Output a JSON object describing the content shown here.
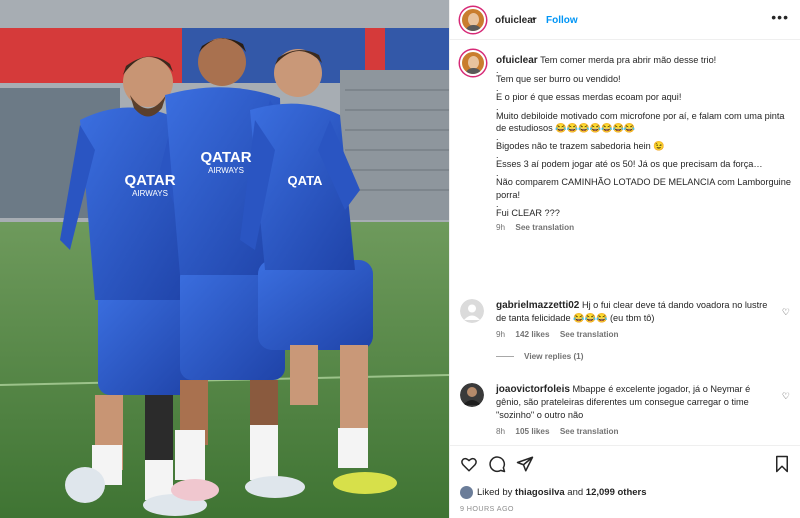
{
  "post": {
    "username": "ofuiclear",
    "follow_label": "Follow",
    "more_label": "•••"
  },
  "photo": {
    "shirt_text": "QATAR AIRWAYS",
    "jersey_lines": [
      "QATAR",
      "AIRWAYS"
    ]
  },
  "caption": {
    "username": "ofuiclear",
    "lines": [
      "Tem comer merda pra abrir mão desse trio!",
      "Tem que ser burro ou vendido!",
      "E o pior é que essas merdas ecoam por aqui!",
      "Muito debiloide motivado com microfone por aí, e falam com uma pinta de estudiosos 😂😂😂😂😂😂😂",
      "Bigodes não te trazem sabedoria hein 😉",
      "Esses 3 aí podem jogar até os 50! Já os que precisam da força…",
      "Não comparem CAMINHÃO LOTADO DE MELANCIA com Lamborguine porra!",
      "Fui CLEAR ???"
    ],
    "time": "9h",
    "see_translation": "See translation"
  },
  "comments": [
    {
      "username": "gabrielmazzetti02",
      "text": "Hj o fui clear deve tá dando voadora no lustre de tanta felicidade 😂😂😂 (eu tbm tô)",
      "time": "9h",
      "likes": "142 likes",
      "see_translation": "See translation",
      "view_replies": "View replies (1)"
    },
    {
      "username": "joaovictorfoleis",
      "text": "Mbappe é excelente jogador, já o Neymar é gênio, são prateleiras diferentes um consegue carregar o time \"sozinho\" o outro não",
      "time": "8h",
      "likes": "105 likes",
      "see_translation": "See translation"
    }
  ],
  "footer": {
    "liked_prefix": "Liked by ",
    "liked_user": "thiagosilva",
    "liked_mid": " and ",
    "liked_count": "12,099 others",
    "ago": "9 HOURS AGO"
  },
  "icons": [
    "heart-icon",
    "comment-icon",
    "share-icon",
    "bookmark-icon",
    "more-icon"
  ],
  "colors": {
    "follow": "#0095f6",
    "kit_blue": "#2f5fd0",
    "pitch": "#5f8f4e",
    "muted": "#737373"
  }
}
